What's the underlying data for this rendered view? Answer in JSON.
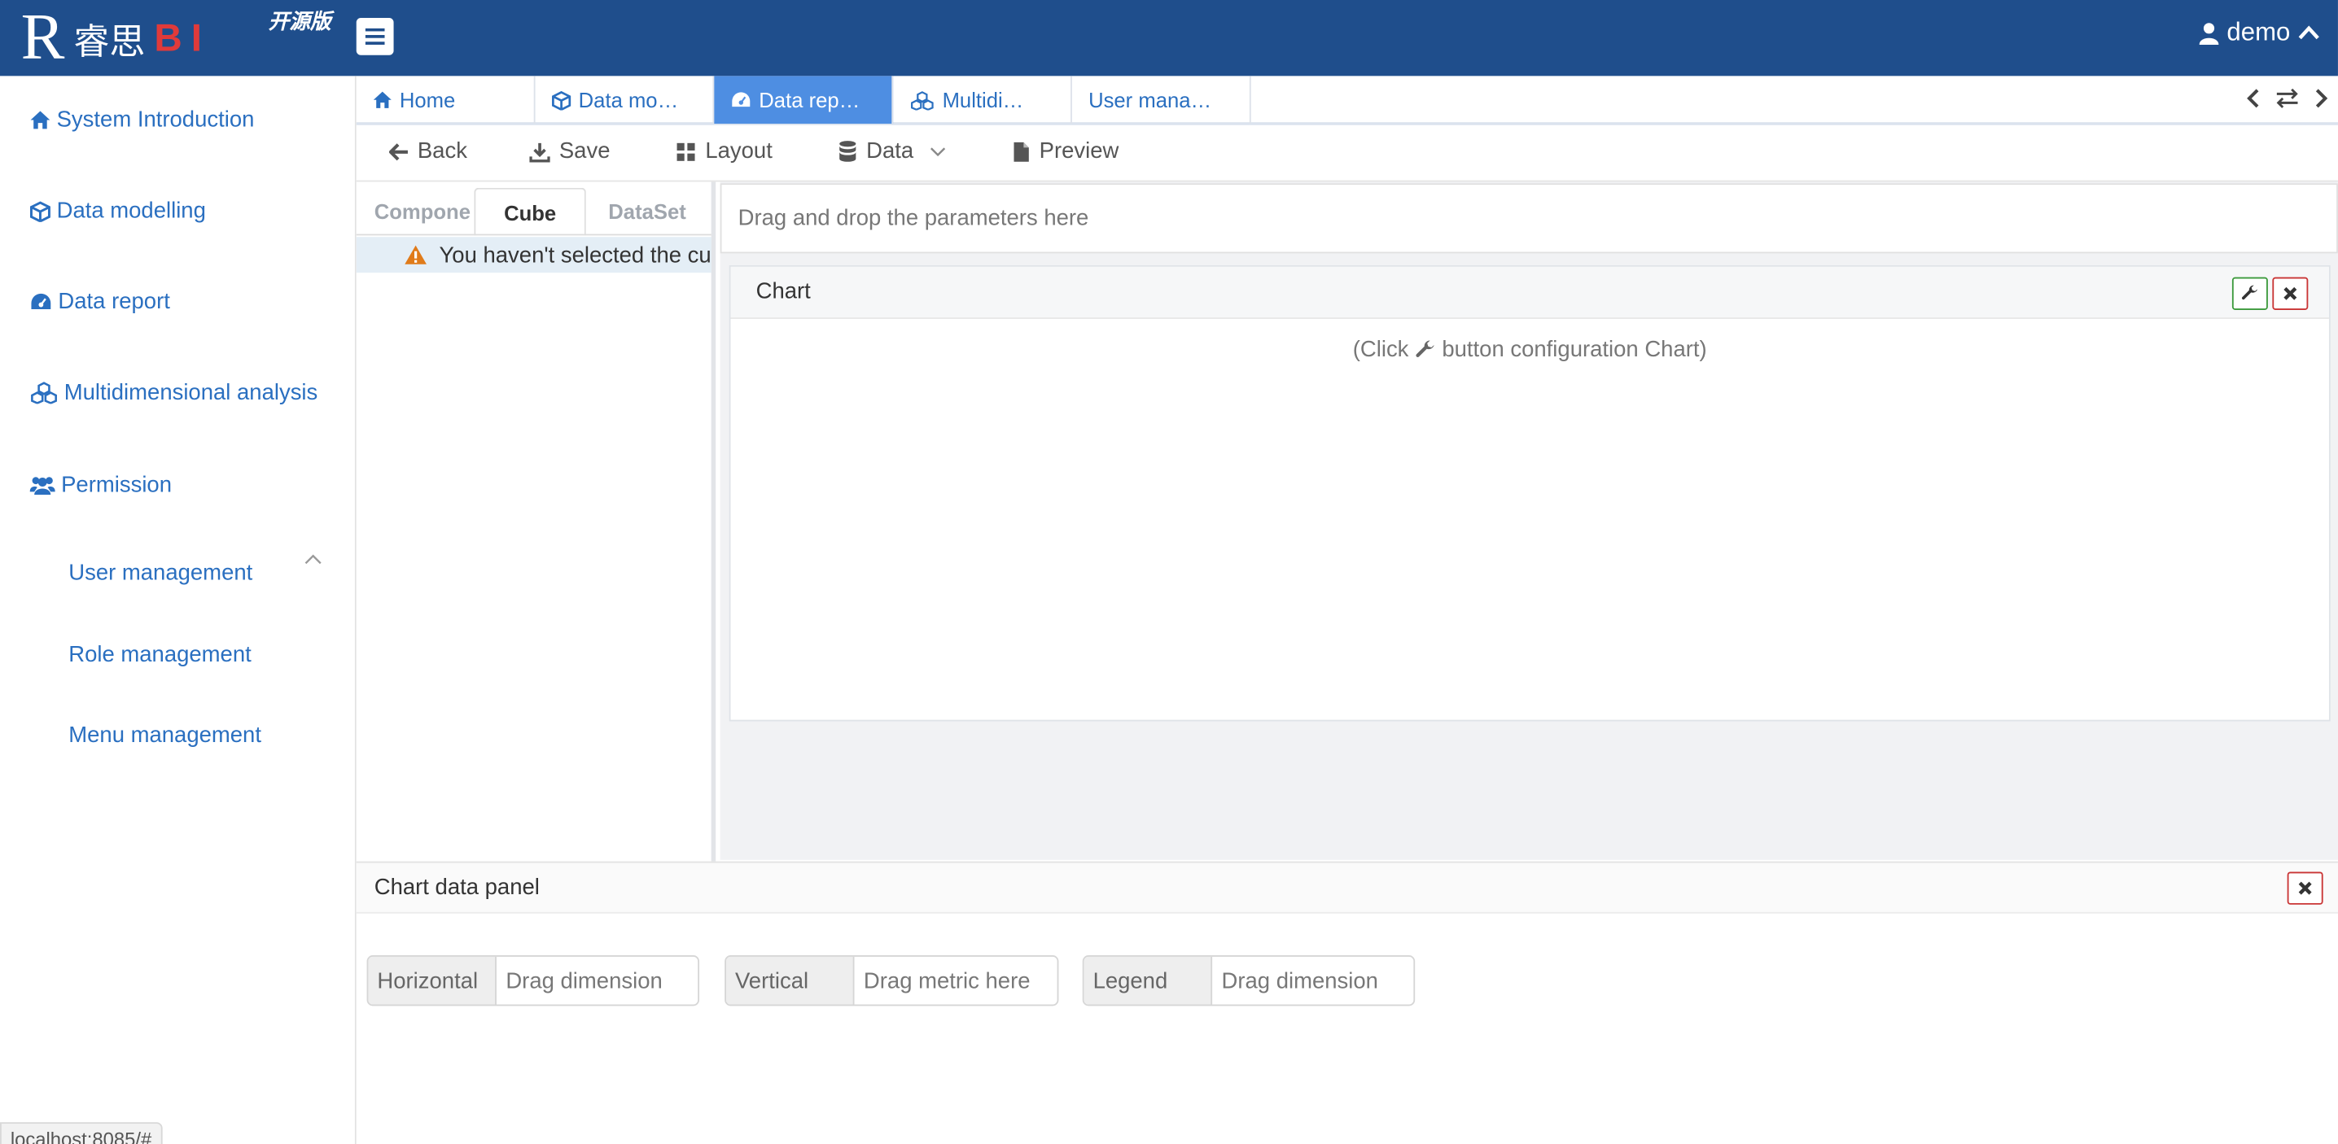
{
  "header": {
    "logo_letter": "R",
    "logo_cn": "睿思",
    "logo_bi": "BI",
    "edition": "开源版",
    "user": "demo"
  },
  "sidebar": {
    "items": [
      {
        "label": "System Introduction",
        "icon": "home-icon"
      },
      {
        "label": "Data modelling",
        "icon": "cube-icon"
      },
      {
        "label": "Data report",
        "icon": "dashboard-icon"
      },
      {
        "label": "Multidimensional analysis",
        "icon": "cubes-icon"
      },
      {
        "label": "Permission",
        "icon": "users-icon"
      }
    ],
    "sub_items": [
      {
        "label": "User management"
      },
      {
        "label": "Role management"
      },
      {
        "label": "Menu management"
      }
    ]
  },
  "tabs": [
    {
      "label": "Home",
      "icon": "home-icon"
    },
    {
      "label": "Data mo…",
      "icon": "cube-icon"
    },
    {
      "label": "Data rep…",
      "icon": "dashboard-icon",
      "active": true
    },
    {
      "label": "Multidi…",
      "icon": "cubes-icon"
    },
    {
      "label": "User mana…"
    }
  ],
  "toolbar": {
    "back": "Back",
    "save": "Save",
    "layout": "Layout",
    "data": "Data",
    "preview": "Preview"
  },
  "left_panel": {
    "tabs": [
      "Compone",
      "Cube",
      "DataSet"
    ],
    "active_tab": "Cube",
    "warning": "You haven't selected the cu"
  },
  "canvas": {
    "drop_hint": "Drag and drop the parameters here",
    "chart_title": "Chart",
    "hint_before": "(Click",
    "hint_after": "button configuration Chart)"
  },
  "data_panel": {
    "title": "Chart data panel",
    "fields": [
      {
        "label": "Horizontal",
        "placeholder": "Drag dimension"
      },
      {
        "label": "Vertical",
        "placeholder": "Drag metric here"
      },
      {
        "label": "Legend",
        "placeholder": "Drag dimension"
      }
    ]
  },
  "status_bar": {
    "url": "localhost:8085/#"
  },
  "colors": {
    "header_bg": "#1f4e8c",
    "active_tab": "#4e8ee2",
    "link": "#2a6fc0",
    "bi_red": "#e03a3a",
    "warning": "#e07b1a"
  }
}
